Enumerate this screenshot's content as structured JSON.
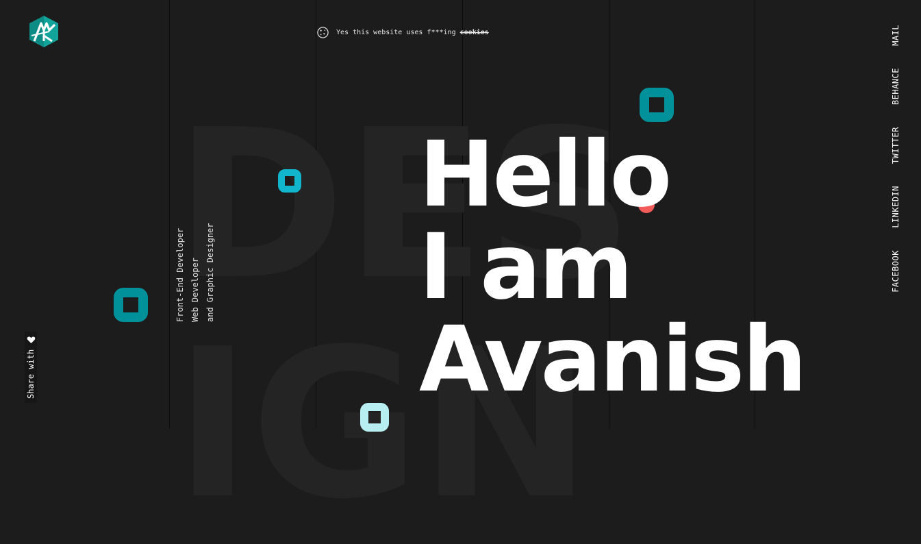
{
  "brand": {
    "logo_text": "AK"
  },
  "cookie_notice": {
    "text": "Yes this website uses f***ing",
    "strike_word": "cookies"
  },
  "background_words": {
    "line1": "DES",
    "line2": "IGN"
  },
  "hero": {
    "line1": "Hello",
    "line2": "I am",
    "line3": "Avanish"
  },
  "roles": [
    "Front-End Developer",
    "Web Developer",
    "and Graphic Designer"
  ],
  "share": {
    "label": "Share with"
  },
  "social_links": [
    "MAIL",
    "BEHANCE",
    "TWITTER",
    "LINKEDIN",
    "FACEBOOK"
  ],
  "colors": {
    "background": "#1c1c1c",
    "accent_teal": "#00919a",
    "accent_cyan": "#11b5cc",
    "accent_light": "#b7eef2",
    "accent_coral": "#f35a5a"
  }
}
